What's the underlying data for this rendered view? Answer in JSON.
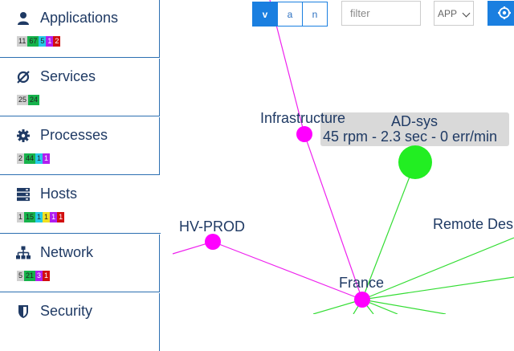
{
  "sidebar": {
    "items": [
      {
        "label": "Applications",
        "badges": [
          "11",
          "67",
          "5",
          "1",
          "2"
        ]
      },
      {
        "label": "Services",
        "badges": [
          "25",
          "24"
        ]
      },
      {
        "label": "Processes",
        "badges": [
          "2",
          "44",
          "1",
          "1"
        ]
      },
      {
        "label": "Hosts",
        "badges": [
          "1",
          "15",
          "1",
          "1",
          "1",
          "1"
        ]
      },
      {
        "label": "Network",
        "badges": [
          "5",
          "21",
          "3",
          "1"
        ]
      },
      {
        "label": "Security"
      }
    ]
  },
  "toolbar": {
    "view_buttons": [
      "v",
      "a",
      "n"
    ],
    "filter_placeholder": "filter",
    "select_value": "APP"
  },
  "graph": {
    "nodes": {
      "infrastructure": "Infrastructure",
      "ad_sys": "AD-sys",
      "hv_prod": "HV-PROD",
      "remote_desktop": "Remote Des",
      "france": "France"
    },
    "tooltip": "45 rpm - 2.3 sec - 0 err/min"
  },
  "colors": {
    "accent": "#1a7fe0",
    "node_magenta": "#ff00ff",
    "node_green": "#22ee22",
    "edge_magenta": "#ee22ee",
    "edge_green": "#33dd33"
  }
}
